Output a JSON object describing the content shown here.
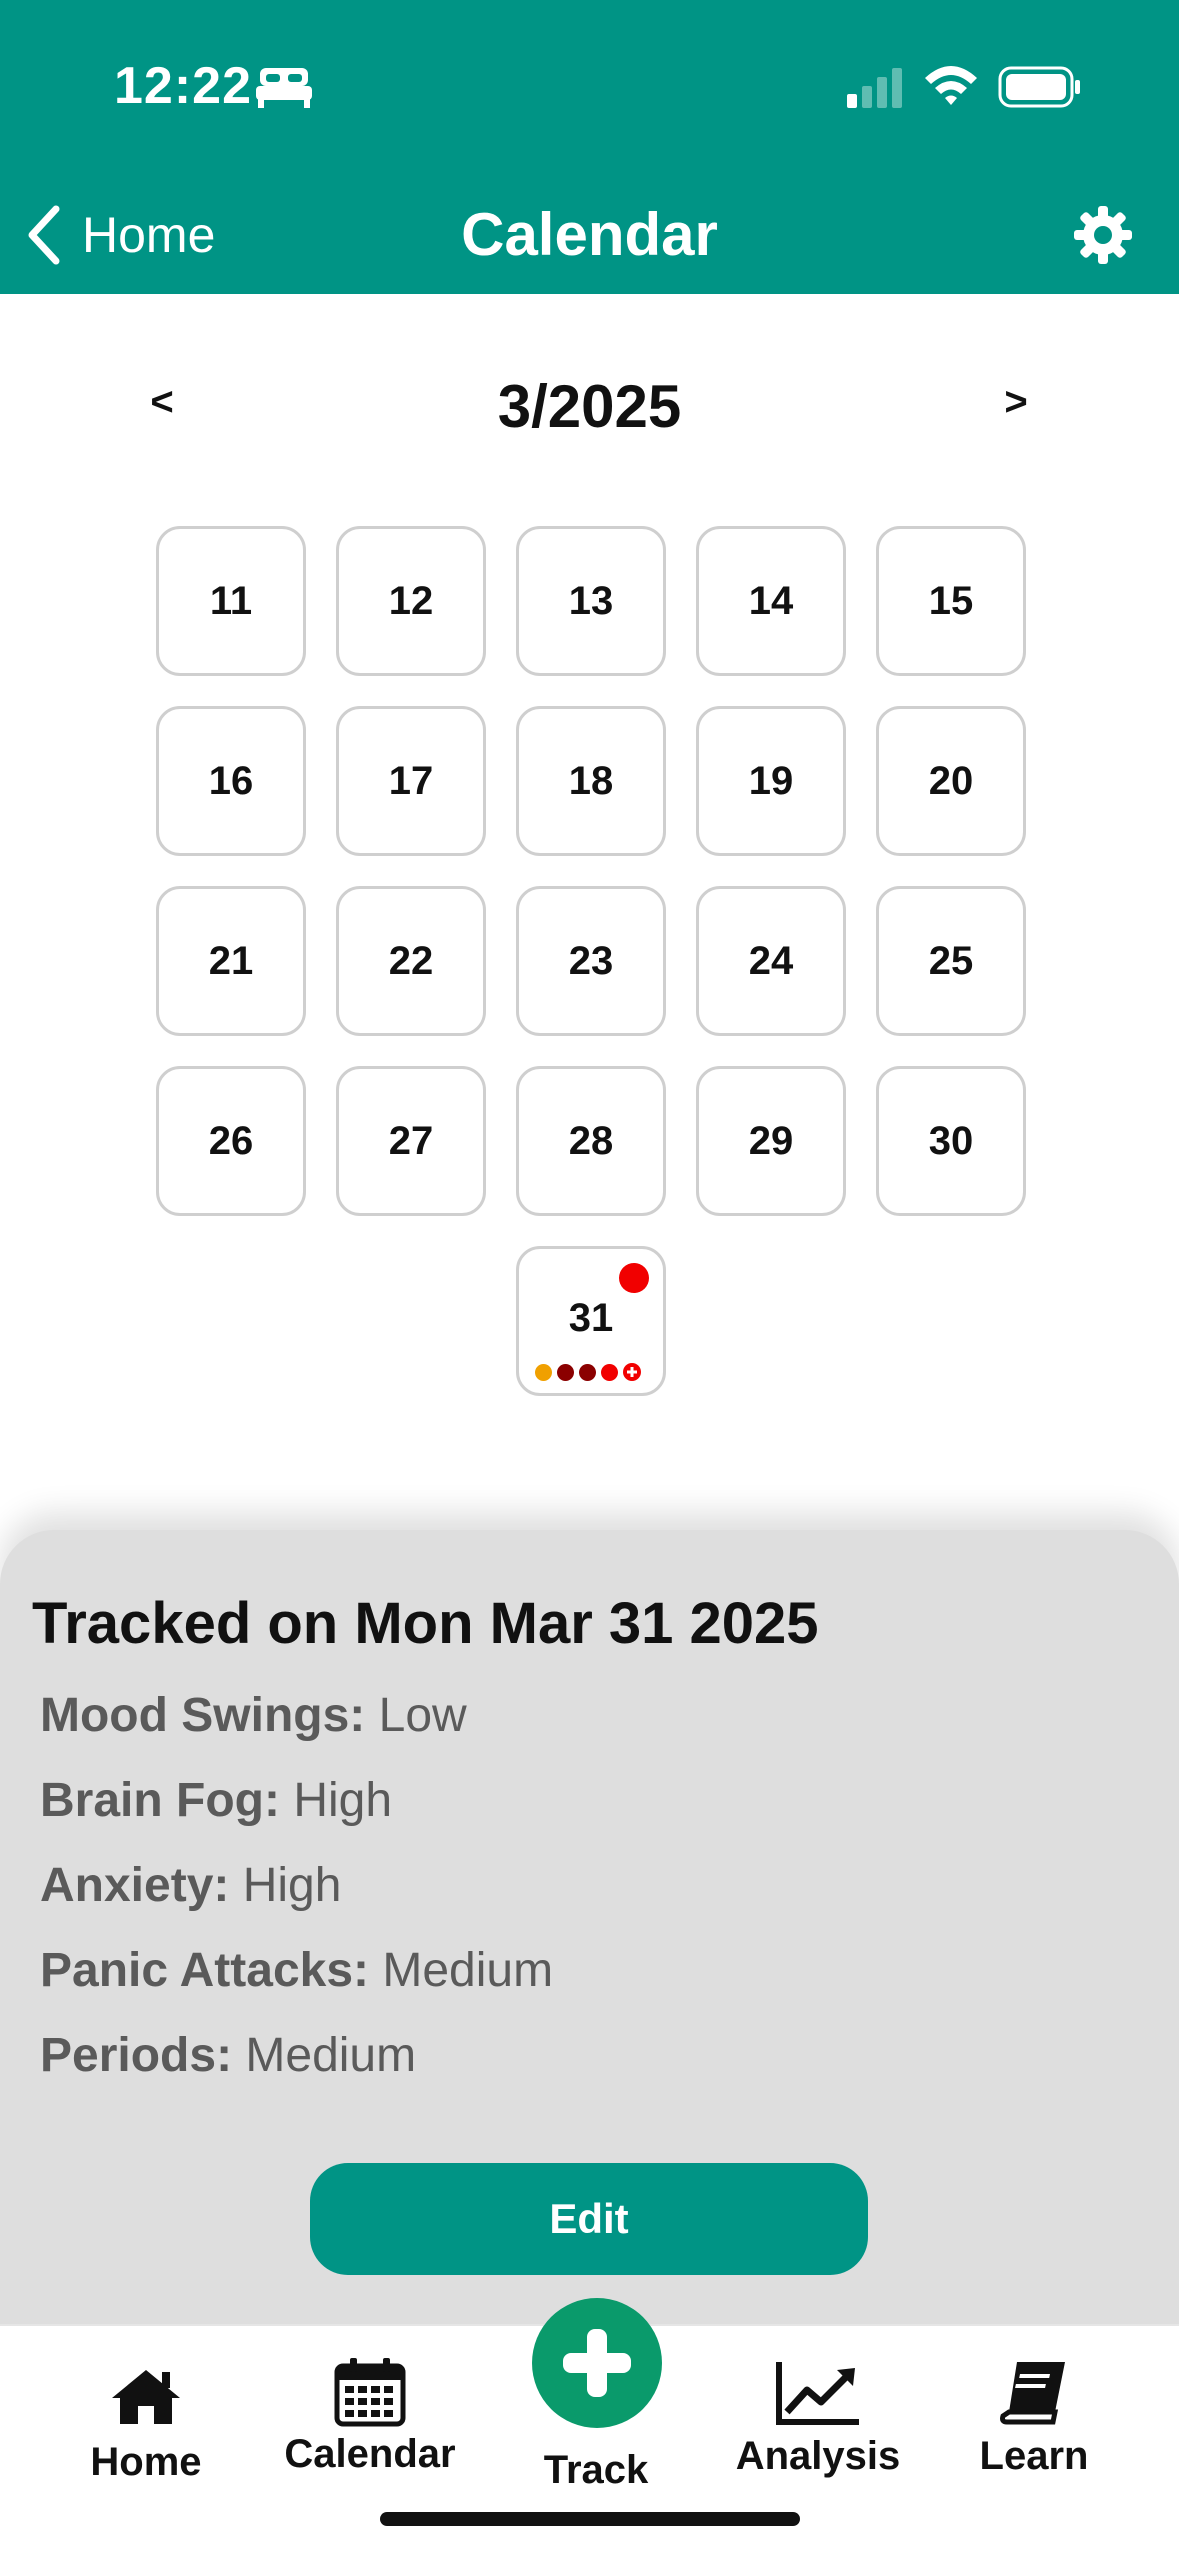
{
  "status_bar": {
    "time": "12:22"
  },
  "nav": {
    "back_label": "Home",
    "title": "Calendar"
  },
  "calendar": {
    "month_label": "3/2025",
    "prev_label": "<",
    "next_label": ">",
    "days": [
      "11",
      "12",
      "13",
      "14",
      "15",
      "16",
      "17",
      "18",
      "19",
      "20",
      "21",
      "22",
      "23",
      "24",
      "25",
      "26",
      "27",
      "28",
      "29",
      "30",
      "31"
    ],
    "selected_day": "31",
    "day31_marker_color": "#f10000",
    "day31_dot_colors": [
      "#f0a000",
      "#8b0000",
      "#8b0000",
      "#f10000",
      "#f10000"
    ]
  },
  "details": {
    "title": "Tracked on Mon Mar 31 2025",
    "rows": [
      {
        "label": "Mood Swings:",
        "value": "Low"
      },
      {
        "label": "Brain Fog:",
        "value": "High"
      },
      {
        "label": "Anxiety:",
        "value": "High"
      },
      {
        "label": "Panic Attacks:",
        "value": "Medium"
      },
      {
        "label": "Periods:",
        "value": "Medium"
      }
    ],
    "edit_label": "Edit"
  },
  "tabs": [
    {
      "label": "Home",
      "icon": "house-icon"
    },
    {
      "label": "Calendar",
      "icon": "calendar-icon"
    },
    {
      "label": "Track",
      "icon": "plus-icon"
    },
    {
      "label": "Analysis",
      "icon": "trend-chart-icon"
    },
    {
      "label": "Learn",
      "icon": "book-icon"
    }
  ],
  "colors": {
    "accent": "#009485",
    "track": "#0a9a6b"
  }
}
